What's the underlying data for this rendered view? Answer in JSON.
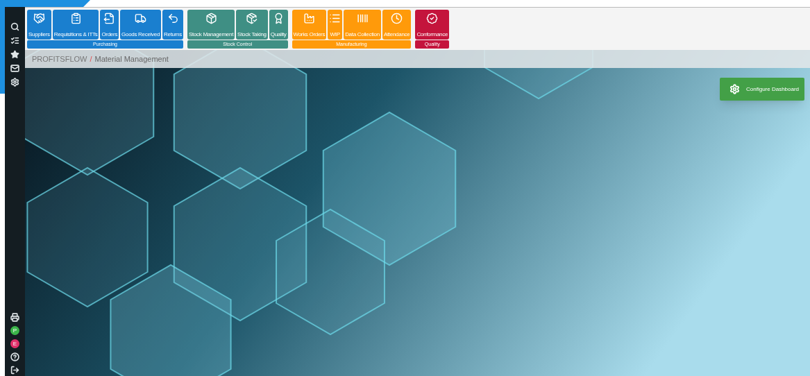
{
  "toolbar": {
    "groups": [
      {
        "label": "Purchasing",
        "color": "#1a7fcf",
        "buttons": [
          {
            "label": "Suppliers"
          },
          {
            "label": "Requisitions & ITTs"
          },
          {
            "label": "Orders"
          },
          {
            "label": "Goods Received"
          },
          {
            "label": "Returns"
          }
        ]
      },
      {
        "label": "Stock Control",
        "color": "#3f8f84",
        "buttons": [
          {
            "label": "Stock Management"
          },
          {
            "label": "Stock Taking"
          },
          {
            "label": "Quality"
          }
        ]
      },
      {
        "label": "Manufacturing",
        "color": "#ff9a0a",
        "buttons": [
          {
            "label": "Works Orders"
          },
          {
            "label": "WIP"
          },
          {
            "label": "Data Collection"
          },
          {
            "label": "Attendance"
          }
        ]
      },
      {
        "label": "Quality",
        "color": "#c4143c",
        "buttons": [
          {
            "label": "Conformance"
          }
        ]
      }
    ]
  },
  "breadcrumb": {
    "root": "PROFITSFLOW",
    "separator": "/",
    "current": "Material Management"
  },
  "sidebar": {
    "badges": [
      {
        "label": "P",
        "color": "#3bb54a"
      },
      {
        "label": "E",
        "color": "#e0306a"
      }
    ]
  },
  "configure_button": {
    "label": "Configure Dashboard"
  }
}
